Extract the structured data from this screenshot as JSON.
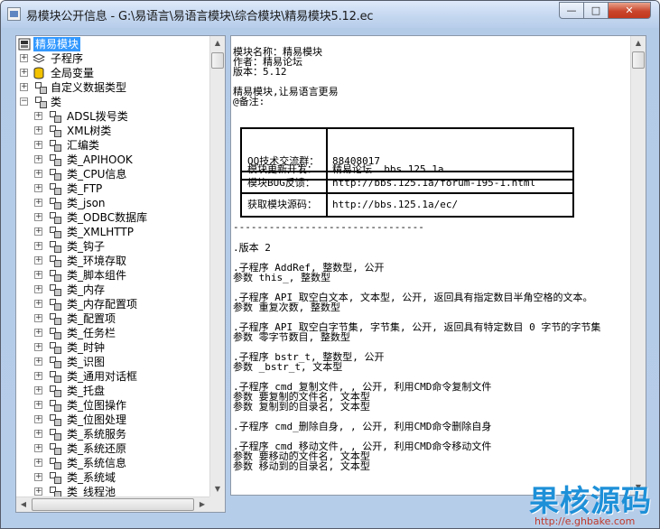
{
  "window": {
    "title": "易模块公开信息 - G:\\易语言\\易语言模块\\综合模块\\精易模块5.12.ec",
    "min_glyph": "—",
    "max_glyph": "□",
    "close_glyph": "✕"
  },
  "tree": {
    "root": "精易模块",
    "top_items": [
      "子程序",
      "全局变量",
      "自定义数据类型",
      "类"
    ],
    "classes": [
      "ADSL拨号类",
      "XML树类",
      "汇编类",
      "类_APIHOOK",
      "类_CPU信息",
      "类_FTP",
      "类_json",
      "类_ODBC数据库",
      "类_XMLHTTP",
      "类_钩子",
      "类_环境存取",
      "类_脚本组件",
      "类_内存",
      "类_内存配置项",
      "类_配置项",
      "类_任务栏",
      "类_时钟",
      "类_识图",
      "类_通用对话框",
      "类_托盘",
      "类_位图操作",
      "类_位图处理",
      "类_系统服务",
      "类_系统还原",
      "类_系统信息",
      "类_系统域",
      "类_线程池"
    ]
  },
  "details": {
    "lines_head": [
      "模块名称：精易模块",
      "作者：精易论坛",
      "版本：5.12",
      "",
      "精易模块,让易语言更易",
      "@备注:"
    ],
    "table": [
      {
        "key": "模块更新开发：",
        "value": "精易论坛  bbs.125.1a"
      },
      {
        "key": "QQ技术交流群：",
        "value": "88408017"
      },
      {
        "key": "模块BUG反馈：",
        "value": "http://bbs.125.1a/forum-195-1.html"
      },
      {
        "key": "获取模块源码：",
        "value": "http://bbs.125.1a/ec/"
      }
    ],
    "separator": "--------------------------------",
    "lines_body": [
      ".版本 2",
      "",
      ".子程序 AddRef, 整数型, 公开",
      "参数 this_, 整数型",
      "",
      ".子程序 API_取空白文本, 文本型, 公开, 返回具有指定数目半角空格的文本。",
      "参数 重复次数, 整数型",
      "",
      ".子程序 API_取空白字节集, 字节集, 公开, 返回具有特定数目 0 字节的字节集",
      "参数 零字节数目, 整数型",
      "",
      ".子程序 bstr_t, 整数型, 公开",
      "参数 _bstr_t, 文本型",
      "",
      ".子程序 cmd_复制文件, , 公开, 利用CMD命令复制文件",
      "参数 要复制的文件名, 文本型",
      "参数 复制到的目录名, 文本型",
      "",
      ".子程序 cmd_删除自身, , 公开, 利用CMD命令删除自身",
      "",
      ".子程序 cmd_移动文件, , 公开, 利用CMD命令移动文件",
      "参数 要移动的文件名, 文本型",
      "参数 移动到的目录名, 文本型"
    ]
  },
  "watermark": {
    "title": "果核源码",
    "url": "http://e.ghbake.com"
  },
  "colors": {
    "selection": "#3399ff",
    "close_button": "#c9452b",
    "watermark_blue": "#1e90d8",
    "watermark_red": "#c0392b"
  }
}
